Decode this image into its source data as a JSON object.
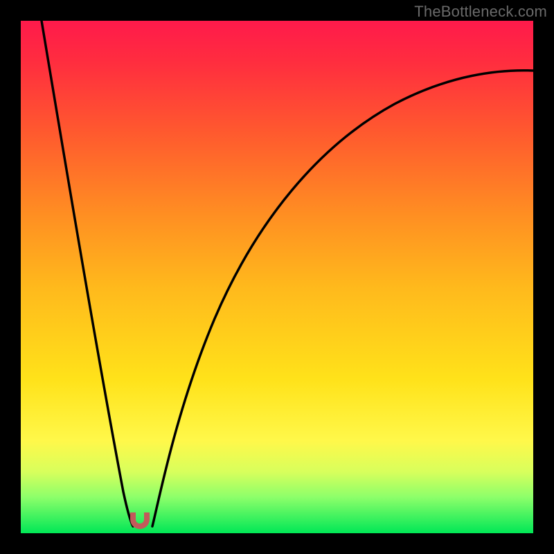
{
  "watermark": "TheBottleneck.com",
  "colors": {
    "frame": "#000000",
    "curve": "#000000",
    "marker": "#c25a5a",
    "gradient_stops": [
      "#ff1a4b",
      "#ff2d3f",
      "#ff5a2e",
      "#ff8f22",
      "#ffb91c",
      "#ffe21a",
      "#fff84a",
      "#d8ff5c",
      "#8cff6a",
      "#00e756"
    ]
  },
  "chart_data": {
    "type": "line",
    "title": "",
    "xlabel": "",
    "ylabel": "",
    "xlim": [
      0,
      100
    ],
    "ylim": [
      0,
      100
    ],
    "series": [
      {
        "name": "left-branch",
        "x": [
          4,
          6,
          8,
          10,
          12,
          14,
          16,
          18,
          20,
          21
        ],
        "values": [
          100,
          88,
          76,
          64,
          52,
          40,
          28,
          16,
          6,
          2
        ]
      },
      {
        "name": "right-branch",
        "x": [
          25,
          27,
          30,
          34,
          38,
          44,
          52,
          62,
          74,
          88,
          100
        ],
        "values": [
          2,
          10,
          22,
          36,
          48,
          60,
          70,
          78,
          84,
          88,
          90
        ]
      }
    ],
    "annotations": [
      {
        "name": "min-marker",
        "x": 23,
        "y": 1
      }
    ]
  }
}
